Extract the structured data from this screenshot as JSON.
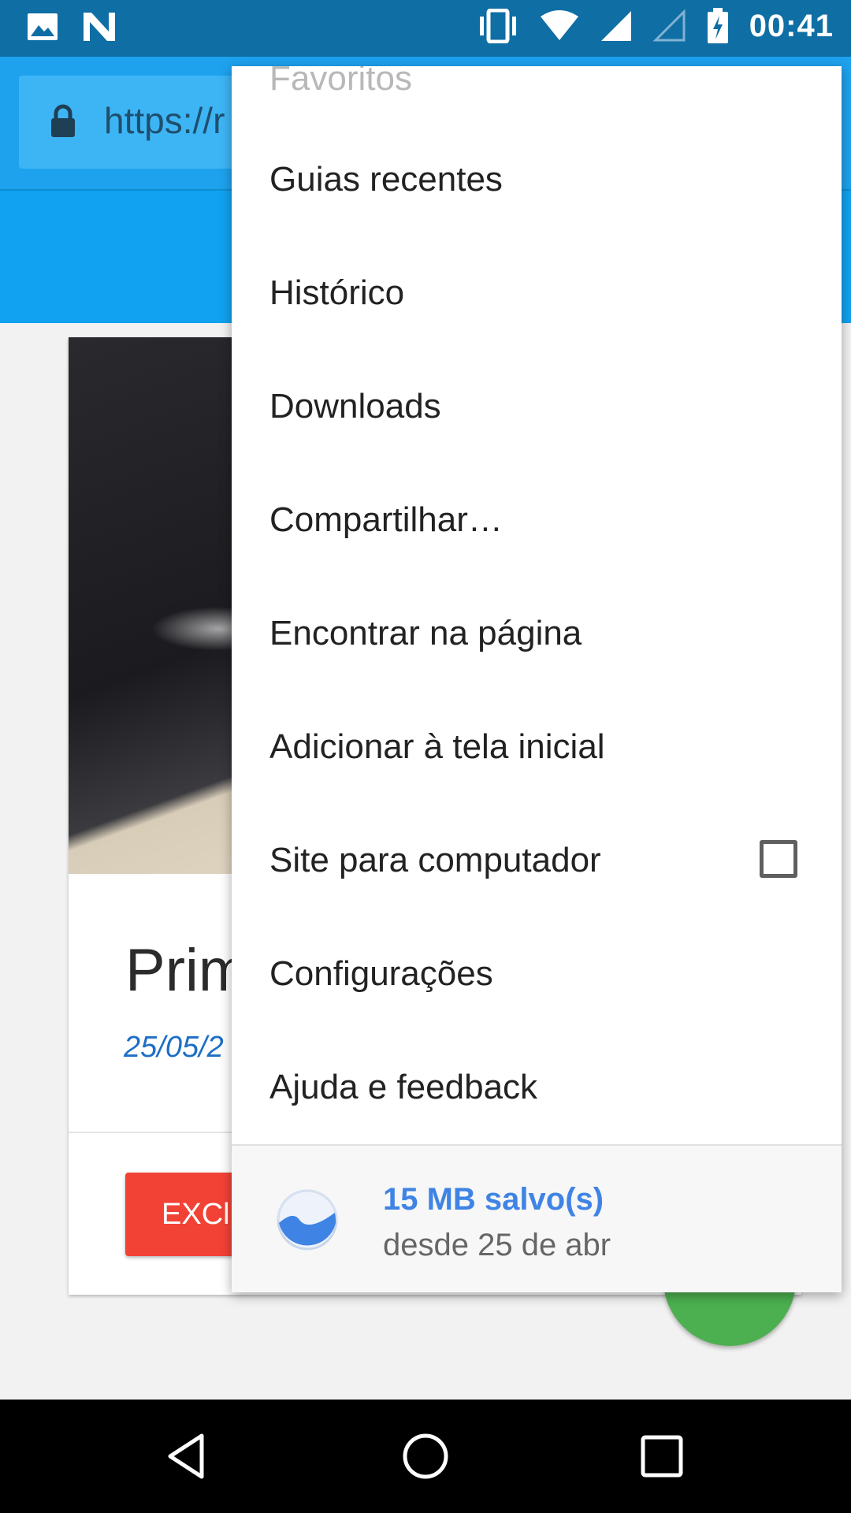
{
  "status_bar": {
    "time": "00:41",
    "icons_left": [
      "image-icon",
      "n-logo-icon"
    ],
    "icons_right": [
      "vibrate-icon",
      "wifi-icon",
      "signal-icon",
      "signal-empty-icon",
      "battery-charging-icon"
    ]
  },
  "toolbar": {
    "url": "https://r"
  },
  "page": {
    "card_title": "Prim",
    "card_date": "25/05/2",
    "delete_label": "EXCl"
  },
  "menu": {
    "items": [
      {
        "label": "Favoritos"
      },
      {
        "label": "Guias recentes"
      },
      {
        "label": "Histórico"
      },
      {
        "label": "Downloads"
      },
      {
        "label": "Compartilhar…"
      },
      {
        "label": "Encontrar na página"
      },
      {
        "label": "Adicionar à tela inicial"
      },
      {
        "label": "Site para computador",
        "checked": false
      },
      {
        "label": "Configurações"
      },
      {
        "label": "Ajuda e feedback"
      }
    ],
    "footer": {
      "saved": "15 MB salvo(s)",
      "since": "desde 25 de abr"
    }
  },
  "colors": {
    "status_bar": "#0f6ea4",
    "toolbar": "#1ea2ee",
    "accent_blue": "#3f84e5",
    "delete_red": "#f24236",
    "fab_green": "#4cb050"
  }
}
